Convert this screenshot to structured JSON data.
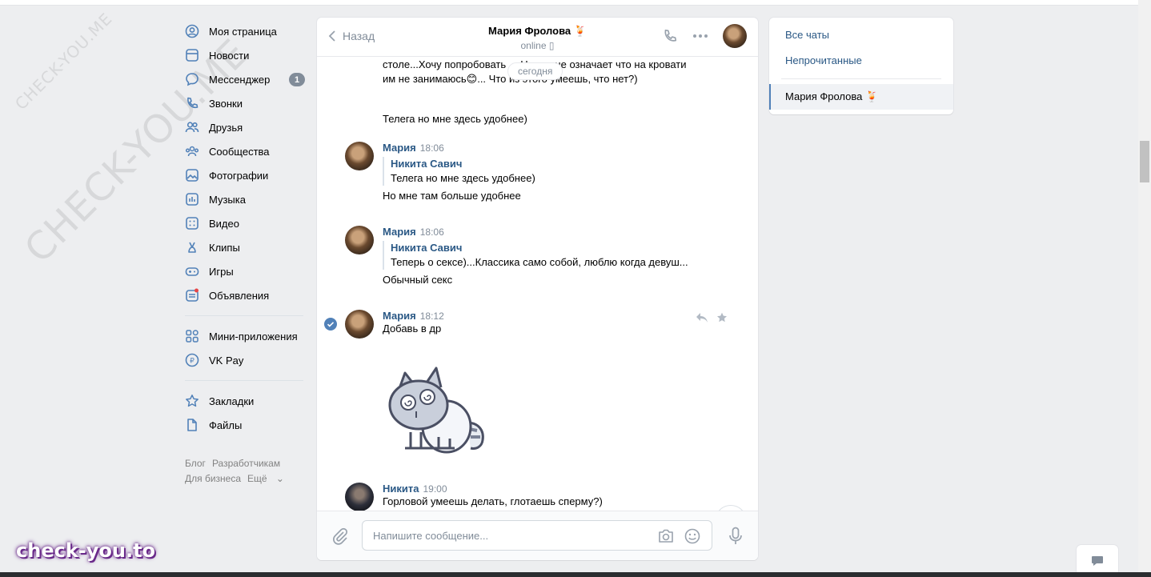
{
  "watermarks": {
    "small": "CHECK-YOU.ME",
    "large": "CHECK-YOU.ME",
    "brand": "check-you.to"
  },
  "nav": {
    "items": [
      {
        "label": "Моя страница",
        "icon": "user-icon"
      },
      {
        "label": "Новости",
        "icon": "news-icon"
      },
      {
        "label": "Мессенджер",
        "icon": "messenger-icon",
        "badge": "1"
      },
      {
        "label": "Звонки",
        "icon": "phone-icon"
      },
      {
        "label": "Друзья",
        "icon": "friends-icon"
      },
      {
        "label": "Сообщества",
        "icon": "communities-icon"
      },
      {
        "label": "Фотографии",
        "icon": "photos-icon"
      },
      {
        "label": "Музыка",
        "icon": "music-icon"
      },
      {
        "label": "Видео",
        "icon": "video-icon"
      },
      {
        "label": "Клипы",
        "icon": "clips-icon"
      },
      {
        "label": "Игры",
        "icon": "games-icon"
      },
      {
        "label": "Объявления",
        "icon": "ads-icon"
      }
    ],
    "items2": [
      {
        "label": "Мини-приложения",
        "icon": "apps-icon"
      },
      {
        "label": "VK Pay",
        "icon": "vkpay-icon"
      }
    ],
    "items3": [
      {
        "label": "Закладки",
        "icon": "bookmarks-icon"
      },
      {
        "label": "Файлы",
        "icon": "files-icon"
      }
    ],
    "footer": {
      "blog": "Блог",
      "dev": "Разработчикам",
      "business": "Для бизнеса",
      "more": "Ещё"
    }
  },
  "chat": {
    "back_label": "Назад",
    "peer_name": "Мария Фролова 🍹",
    "peer_status": "online",
    "date_pill": "сегодня",
    "partial_text_1": "столе...Хочу попробовать ... Но это не означает что на кровати им не занимаюсь😊... Что из этого умеешь, что нет?)",
    "partial_text_2": "Телега но мне здесь удобнее)",
    "messages": [
      {
        "author": "Мария",
        "time": "18:06",
        "fwd_author": "Никита Савич",
        "fwd_text": "Телега но мне здесь удобнее)",
        "text": "Но мне там больше удобнее"
      },
      {
        "author": "Мария",
        "time": "18:06",
        "fwd_author": "Никита Савич",
        "fwd_text": "Теперь о сексе)...Классика само собой, люблю когда девуш...",
        "text": "Обычный секс"
      },
      {
        "author": "Мария",
        "time": "18:12",
        "text": "Добавь в др"
      },
      {
        "author": "Никита",
        "time": "19:00",
        "text": "Горловой умеешь делать, глотаешь сперму?)"
      }
    ],
    "composer_placeholder": "Напишите сообщение..."
  },
  "right_panel": {
    "all_chats": "Все чаты",
    "unread": "Непрочитанные",
    "active_chat": "Мария Фролова 🍹"
  },
  "colors": {
    "link": "#2a5885",
    "accent": "#5181b8",
    "bg": "#edeef0"
  }
}
